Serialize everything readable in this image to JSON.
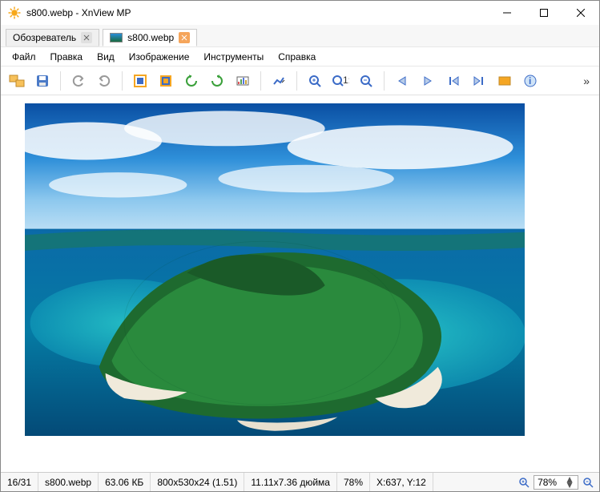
{
  "titlebar": {
    "title": "s800.webp - XnView MP"
  },
  "tabs": {
    "browser": "Обозреватель",
    "file": "s800.webp"
  },
  "menus": {
    "file": "Файл",
    "edit": "Правка",
    "view": "Вид",
    "image": "Изображение",
    "tools": "Инструменты",
    "help": "Справка"
  },
  "toolbar_icons": {
    "browser": "browser-icon",
    "save": "save-icon",
    "undo": "undo-icon",
    "redo": "redo-icon",
    "fullscreen": "fullscreen-icon",
    "crop": "crop-icon",
    "rotate_ccw": "rotate-ccw-icon",
    "rotate_cw": "rotate-cw-icon",
    "adjust": "adjust-levels-icon",
    "auto": "auto-levels-icon",
    "zoom_in": "zoom-in-icon",
    "zoom_100": "zoom-100-icon",
    "zoom_out": "zoom-out-icon",
    "prev": "prev-icon",
    "next": "next-icon",
    "first": "first-icon",
    "last": "last-icon",
    "slideshow": "slideshow-icon",
    "info": "info-icon"
  },
  "status": {
    "index": "16/31",
    "filename": "s800.webp",
    "size": "63.06 КБ",
    "dims": "800x530x24 (1.51)",
    "inches": "11.11x7.36 дюйма",
    "zoom_pct": "78%",
    "coords": "X:637, Y:12",
    "zoom_value": "78%"
  }
}
